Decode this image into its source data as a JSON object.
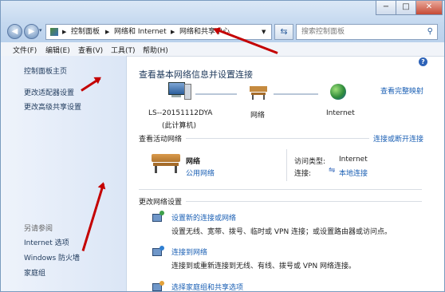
{
  "window": {
    "minimize": "−",
    "maximize": "□",
    "close": "✕"
  },
  "address": {
    "seg1": "控制面板",
    "seg2": "网络和 Internet",
    "seg3": "网络和共享中心",
    "search_placeholder": "搜索控制面板"
  },
  "menu": [
    "文件(F)",
    "编辑(E)",
    "查看(V)",
    "工具(T)",
    "帮助(H)"
  ],
  "sidebar": {
    "home": "控制面板主页",
    "adapter": "更改适配器设置",
    "advanced": "更改高级共享设置",
    "see_also": "另请参阅",
    "internet_options": "Internet 选项",
    "firewall": "Windows 防火墙",
    "homegroup": "家庭组"
  },
  "main": {
    "heading": "查看基本网络信息并设置连接",
    "full_map": "查看完整映射",
    "computer_name": "LS--20151112DYA",
    "computer_sub": "(此计算机)",
    "network_label": "网络",
    "internet_label": "Internet",
    "active_title": "查看活动网络",
    "connect_link": "连接或断开连接",
    "network_name": "网络",
    "network_type": "公用网络",
    "access_type_label": "访问类型:",
    "access_type_value": "Internet",
    "connection_label": "连接:",
    "connection_value": "本地连接",
    "change_title": "更改网络设置",
    "task1_title": "设置新的连接或网络",
    "task1_desc": "设置无线、宽带、拨号、临时或 VPN 连接；或设置路由器或访问点。",
    "task2_title": "连接到网络",
    "task2_desc": "连接到或重新连接到无线、有线、拨号或 VPN 网络连接。",
    "task3_title": "选择家庭组和共享选项"
  },
  "colors": {
    "link": "#1a5fb4",
    "heading": "#1e395b",
    "annotation_arrow": "#c40000"
  }
}
